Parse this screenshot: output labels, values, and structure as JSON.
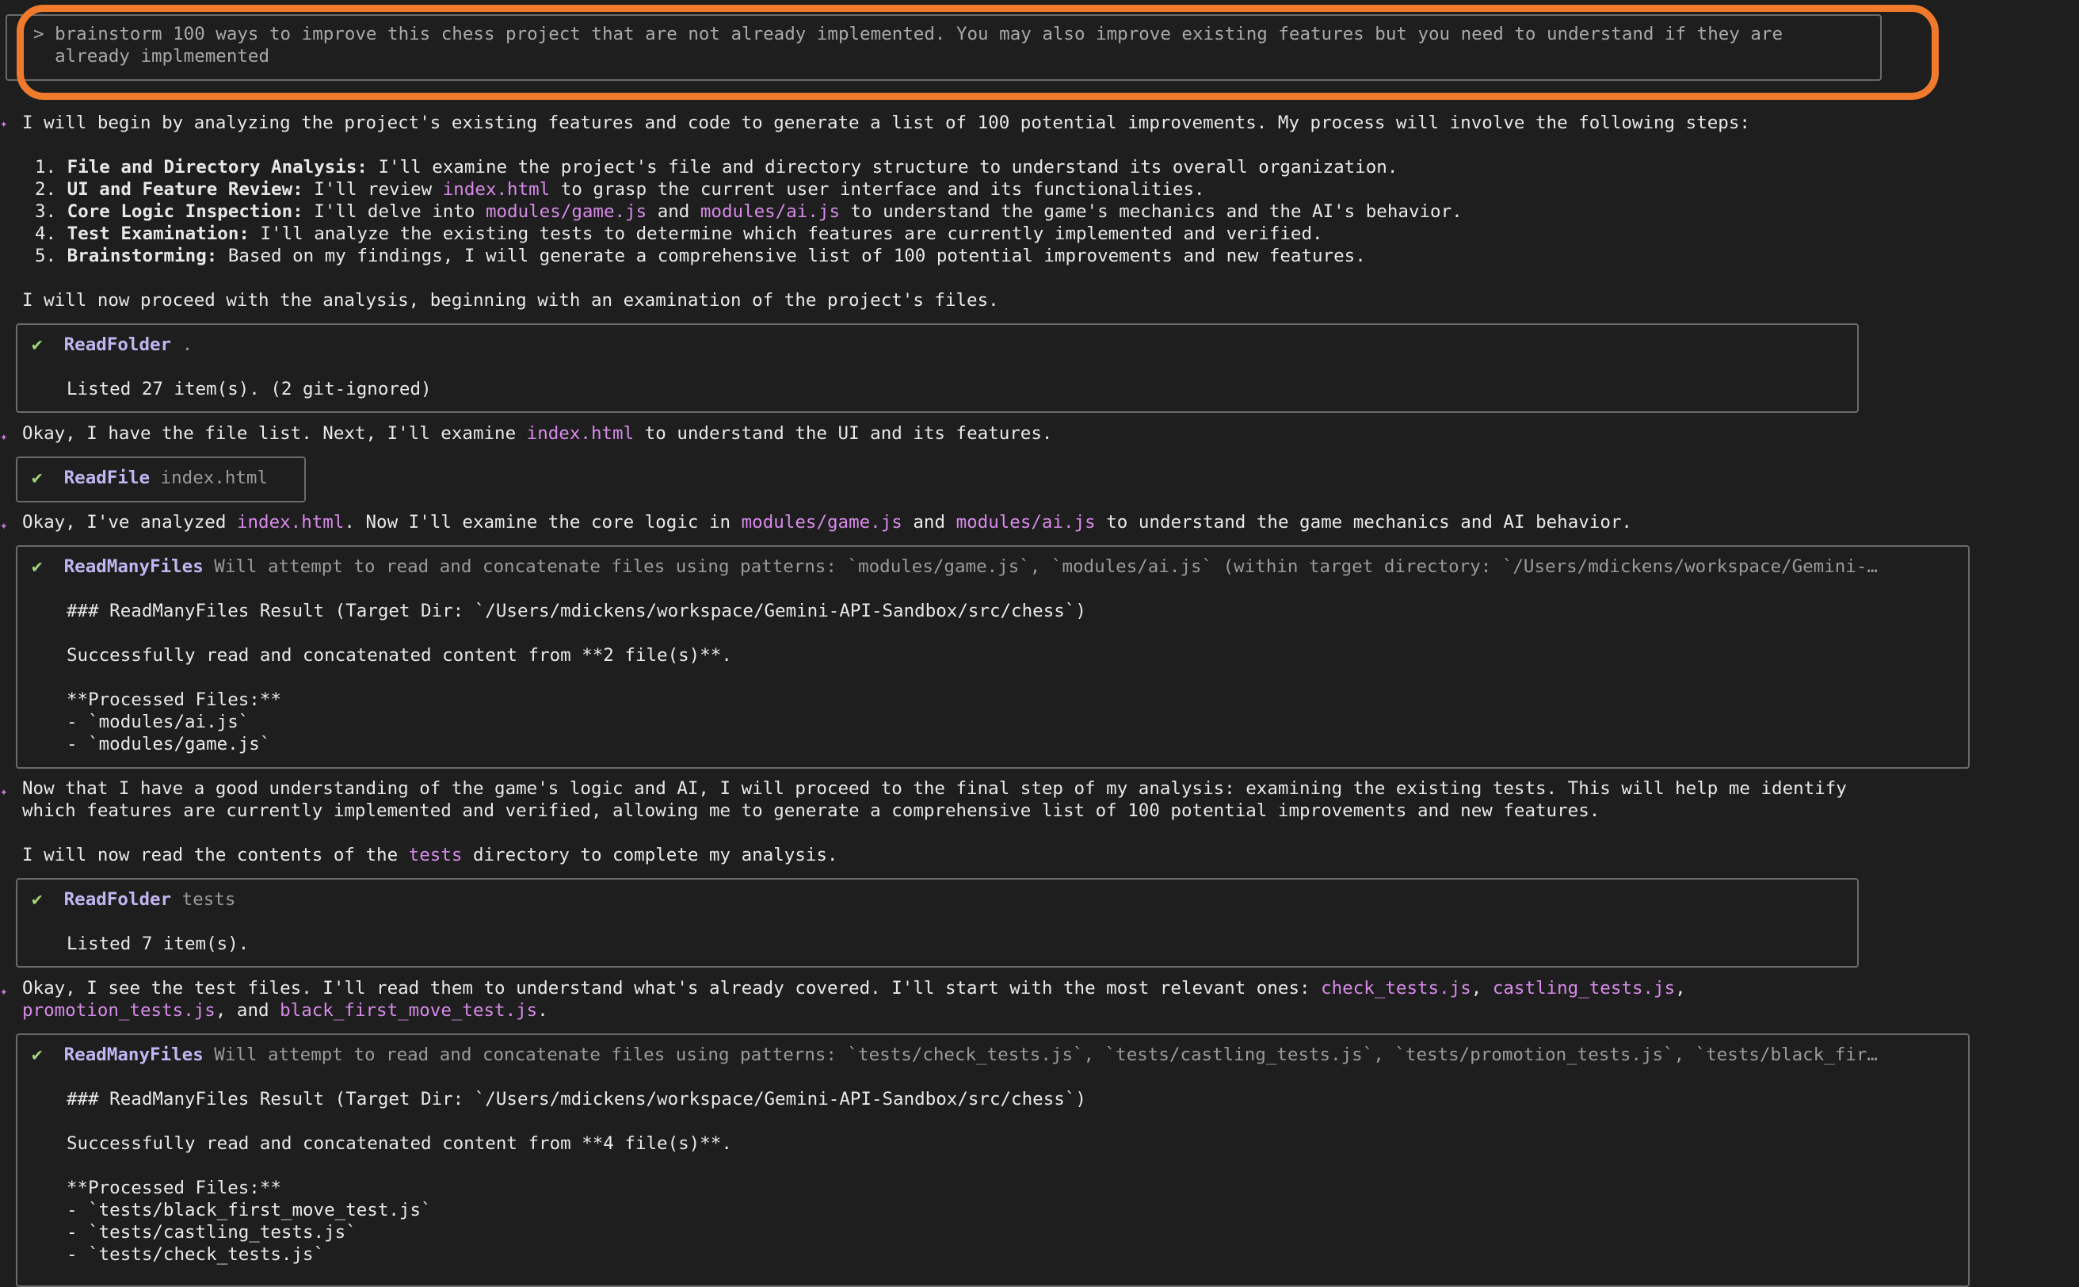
{
  "prompt": {
    "line1": "> brainstorm 100 ways to improve this chess project that are not already implemented. You may also improve existing features but you need to understand if they are",
    "line2": "  already implmemented"
  },
  "msg1": {
    "intro": "I will begin by analyzing the project's existing features and code to generate a list of 100 potential improvements. My process will involve the following steps:",
    "steps": [
      {
        "num": "1. ",
        "title": "File and Directory Analysis:",
        "text": " I'll examine the project's file and directory structure to understand its overall organization."
      },
      {
        "num": "2. ",
        "title": "UI and Feature Review:",
        "t1": " I'll review ",
        "file": "index.html",
        "t2": " to grasp the current user interface and its functionalities."
      },
      {
        "num": "3. ",
        "title": "Core Logic Inspection:",
        "t1": " I'll delve into ",
        "file1": "modules/game.js",
        "t2": " and ",
        "file2": "modules/ai.js",
        "t3": " to understand the game's mechanics and the AI's behavior."
      },
      {
        "num": "4. ",
        "title": "Test Examination:",
        "text": " I'll analyze the existing tests to determine which features are currently implemented and verified."
      },
      {
        "num": "5. ",
        "title": "Brainstorming:",
        "text": " Based on my findings, I will generate a comprehensive list of 100 potential improvements and new features."
      }
    ],
    "outro": "I will now proceed with the analysis, beginning with an examination of the project's files."
  },
  "tool1": {
    "check": "✔",
    "name": "ReadFolder",
    "desc": " .",
    "result": "Listed 27 item(s). (2 git-ignored)"
  },
  "msg2": {
    "t1": "Okay, I have the file list. Next, I'll examine ",
    "file": "index.html",
    "t2": " to understand the UI and its features."
  },
  "tool2": {
    "check": "✔",
    "name": "ReadFile",
    "desc": " index.html"
  },
  "msg3": {
    "t1": "Okay, I've analyzed ",
    "file1": "index.html",
    "t2": ". Now I'll examine the core logic in ",
    "file2": "modules/game.js",
    "t3": " and ",
    "file3": "modules/ai.js",
    "t4": " to understand the game mechanics and AI behavior."
  },
  "tool3": {
    "check": "✔",
    "name": "ReadManyFiles",
    "desc": " Will attempt to read and concatenate files using patterns: `modules/game.js`, `modules/ai.js` (within target directory: `/Users/mdickens/workspace/Gemini-…",
    "r1": "### ReadManyFiles Result (Target Dir: `/Users/mdickens/workspace/Gemini-API-Sandbox/src/chess`)",
    "r2": "Successfully read and concatenated content from **2 file(s)**.",
    "r3": "**Processed Files:**",
    "r4": "- `modules/ai.js`",
    "r5": "- `modules/game.js`"
  },
  "msg4": {
    "l1": "Now that I have a good understanding of the game's logic and AI, I will proceed to the final step of my analysis: examining the existing tests. This will help me identify",
    "l2": "which features are currently implemented and verified, allowing me to generate a comprehensive list of 100 potential improvements and new features.",
    "l3a": "I will now read the contents of the ",
    "l3file": "tests",
    "l3b": " directory to complete my analysis."
  },
  "tool4": {
    "check": "✔",
    "name": "ReadFolder",
    "desc": " tests",
    "result": "Listed 7 item(s)."
  },
  "msg5": {
    "t1": "Okay, I see the test files. I'll read them to understand what's already covered. I'll start with the most relevant ones: ",
    "f1": "check_tests.js",
    "c1": ", ",
    "f2": "castling_tests.js",
    "c2": ",",
    "f3": "promotion_tests.js",
    "c3": ", and ",
    "f4": "black_first_move_test.js",
    "c4": "."
  },
  "tool5": {
    "check": "✔",
    "name": "ReadManyFiles",
    "desc": " Will attempt to read and concatenate files using patterns: `tests/check_tests.js`, `tests/castling_tests.js`, `tests/promotion_tests.js`, `tests/black_fir…",
    "r1": "### ReadManyFiles Result (Target Dir: `/Users/mdickens/workspace/Gemini-API-Sandbox/src/chess`)",
    "r2": "Successfully read and concatenated content from **4 file(s)**.",
    "r3": "**Processed Files:**",
    "r4": "- `tests/black_first_move_test.js`",
    "r5": "- `tests/castling_tests.js`",
    "r6": "- `tests/check_tests.js`"
  },
  "icons": {
    "assistant": "✦",
    "success": "check-icon"
  },
  "colors": {
    "highlight": "#f07a2b",
    "file": "#d68ae8",
    "tool": "#c2b6f2",
    "check": "#a6d67a"
  }
}
